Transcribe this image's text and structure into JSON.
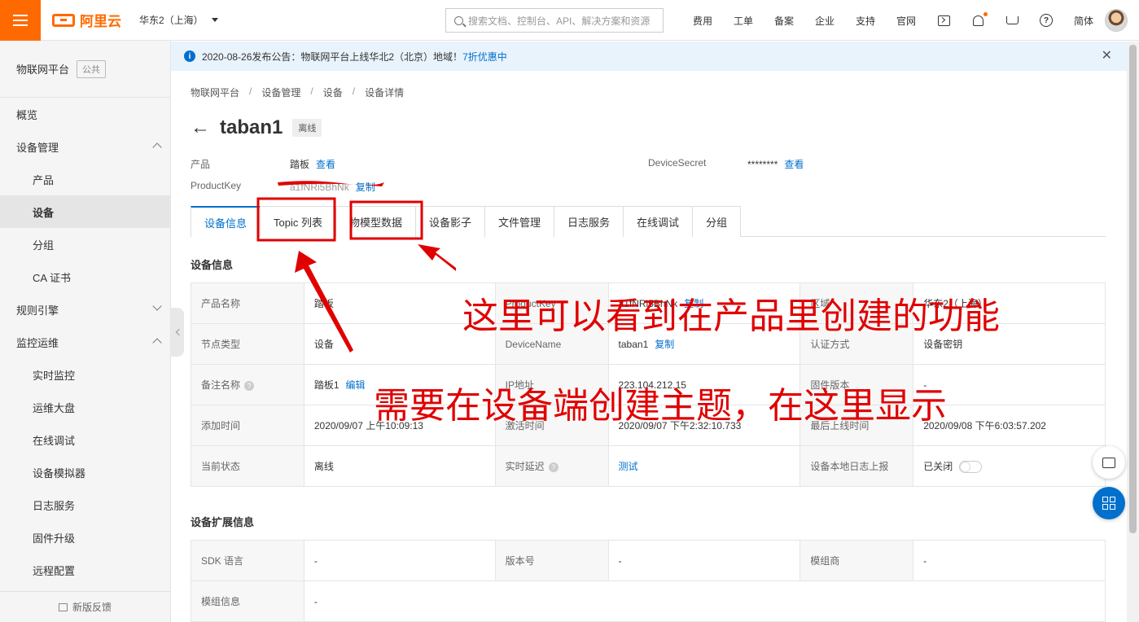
{
  "topbar": {
    "logo_text": "阿里云",
    "region": "华东2（上海）",
    "search_placeholder": "搜索文档、控制台、API、解决方案和资源",
    "links": [
      "费用",
      "工单",
      "备案",
      "企业",
      "支持",
      "官网"
    ],
    "lang": "简体",
    "brand_color": "#ff6a00"
  },
  "sidebar": {
    "title": "物联网平台",
    "tag": "公共",
    "items": [
      {
        "label": "概览"
      },
      {
        "label": "设备管理"
      },
      {
        "label": "产品"
      },
      {
        "label": "设备"
      },
      {
        "label": "分组"
      },
      {
        "label": "CA 证书"
      },
      {
        "label": "规则引擎"
      },
      {
        "label": "监控运维"
      },
      {
        "label": "实时监控"
      },
      {
        "label": "运维大盘"
      },
      {
        "label": "在线调试"
      },
      {
        "label": "设备模拟器"
      },
      {
        "label": "日志服务"
      },
      {
        "label": "固件升级"
      },
      {
        "label": "远程配置"
      }
    ],
    "footer": "新版反馈"
  },
  "notice": {
    "text": "2020-08-26发布公告：物联网平台上线华北2（北京）地域！",
    "promo": "7折优惠中"
  },
  "breadcrumb": [
    "物联网平台",
    "设备管理",
    "设备",
    "设备详情"
  ],
  "device": {
    "name": "taban1",
    "status": "离线",
    "product_label": "产品",
    "product_value": "踏板",
    "view_link": "查看",
    "productkey_label": "ProductKey",
    "productkey_value": "a1fNRi5BhNk",
    "copy_link": "复制",
    "secret_label": "DeviceSecret",
    "secret_value": "********",
    "secret_view": "查看"
  },
  "tabs": [
    "设备信息",
    "Topic 列表",
    "物模型数据",
    "设备影子",
    "文件管理",
    "日志服务",
    "在线调试",
    "分组"
  ],
  "info_section": {
    "title": "设备信息",
    "rows": [
      [
        {
          "k": "产品名称",
          "v": "踏板"
        },
        {
          "k": "ProductKey",
          "v": "a1fNRi5BhNk",
          "link": "复制"
        },
        {
          "k": "区域",
          "v": "华东2（上海）"
        }
      ],
      [
        {
          "k": "节点类型",
          "v": "设备"
        },
        {
          "k": "DeviceName",
          "v": "taban1",
          "link": "复制"
        },
        {
          "k": "认证方式",
          "v": "设备密钥"
        }
      ],
      [
        {
          "k": "备注名称",
          "v": "踏板1",
          "link": "编辑",
          "help": true
        },
        {
          "k": "IP地址",
          "v": "223.104.212.15"
        },
        {
          "k": "固件版本",
          "v": "-"
        }
      ],
      [
        {
          "k": "添加时间",
          "v": "2020/09/07 上午10:09:13"
        },
        {
          "k": "激活时间",
          "v": "2020/09/07 下午2:32:10.733"
        },
        {
          "k": "最后上线时间",
          "v": "2020/09/08 下午6:03:57.202"
        }
      ],
      [
        {
          "k": "当前状态",
          "v": "离线"
        },
        {
          "k": "实时延迟",
          "v": "测试",
          "help": true,
          "vlink": true
        },
        {
          "k": "设备本地日志上报",
          "v": "已关闭",
          "toggle": true
        }
      ]
    ]
  },
  "ext_section": {
    "title": "设备扩展信息",
    "rows": [
      [
        {
          "k": "SDK 语言",
          "v": "-"
        },
        {
          "k": "版本号",
          "v": "-"
        },
        {
          "k": "模组商",
          "v": "-"
        }
      ],
      [
        {
          "k": "模组信息",
          "v": "-"
        }
      ]
    ]
  },
  "annotations": {
    "text1": "这里可以看到在产品里创建的功能",
    "text2": "需要在设备端创建主题，在这里显示",
    "color": "#e00000"
  }
}
